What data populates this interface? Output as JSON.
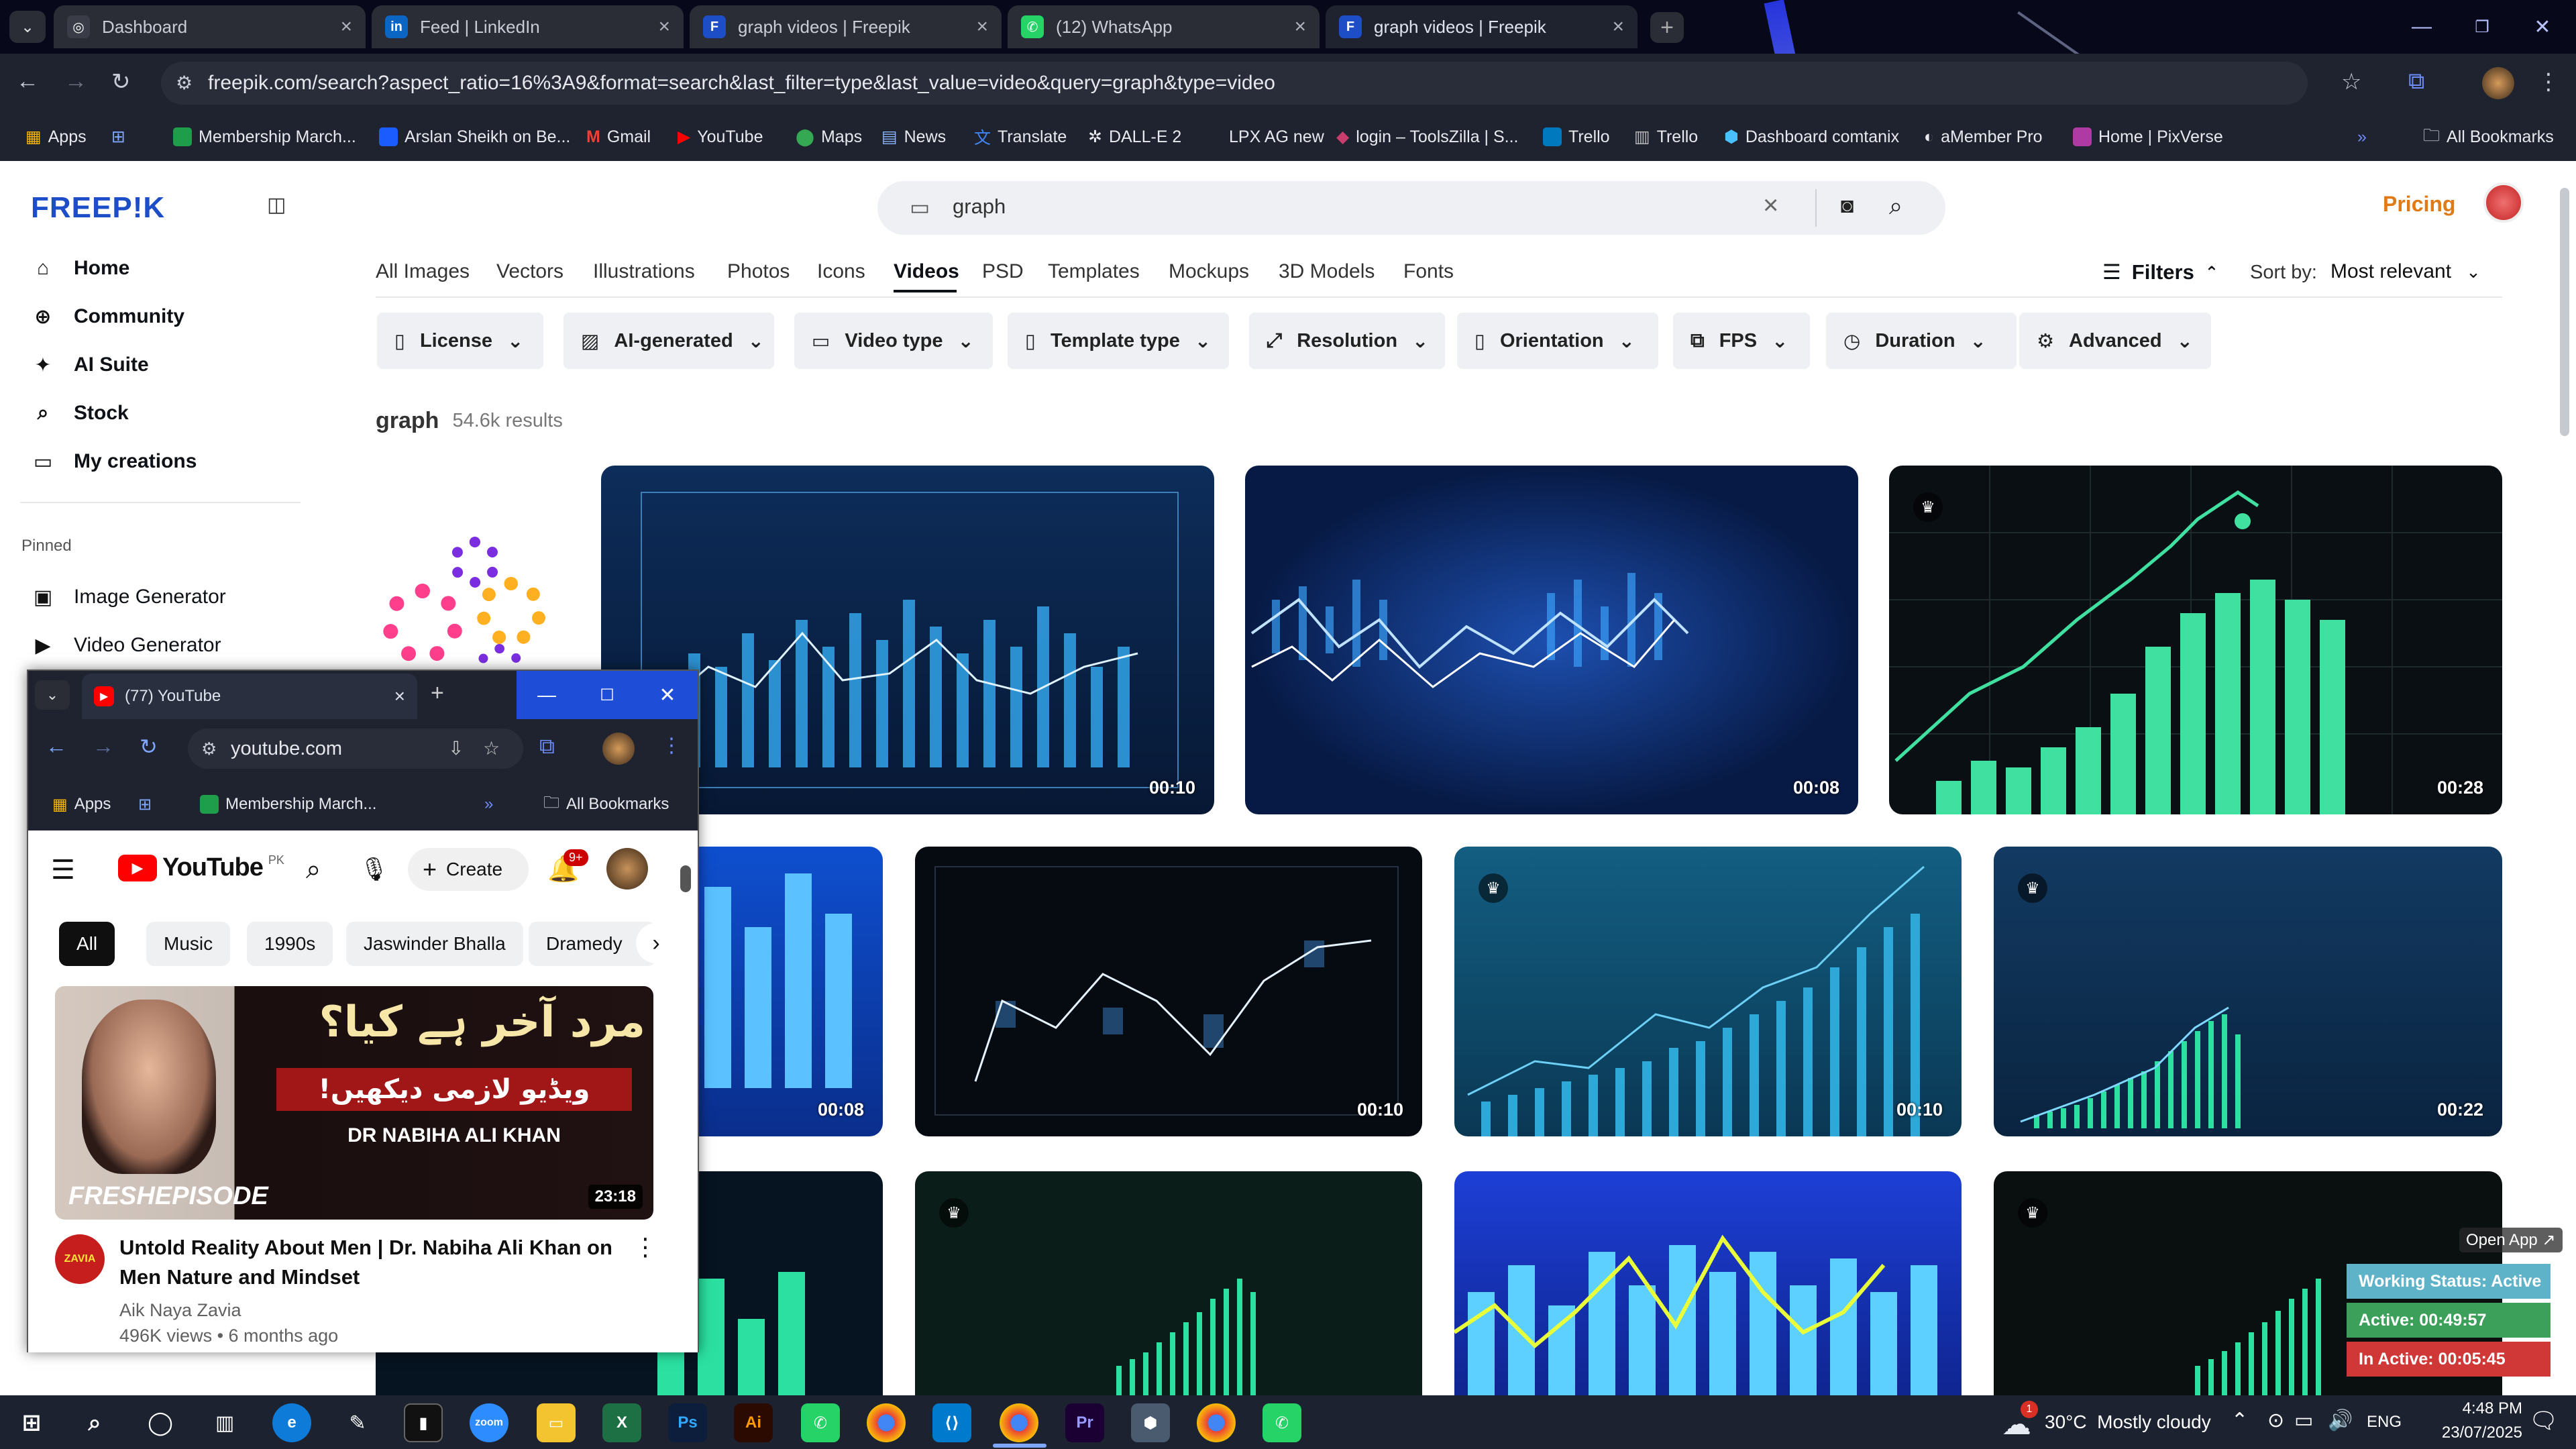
{
  "browser": {
    "tabs": [
      {
        "title": "Dashboard",
        "favicon": "globe-icon"
      },
      {
        "title": "Feed | LinkedIn",
        "favicon": "linkedin-icon"
      },
      {
        "title": "graph videos | Freepik",
        "favicon": "freepik-icon"
      },
      {
        "title": "(12) WhatsApp",
        "favicon": "whatsapp-icon"
      },
      {
        "title": "graph videos | Freepik",
        "favicon": "freepik-icon"
      }
    ],
    "url": "freepik.com/search?aspect_ratio=16%3A9&format=search&last_filter=type&last_value=video&query=graph&type=video",
    "bookmarks": [
      "Apps",
      "Membership March...",
      "Arslan Sheikh on Be...",
      "Gmail",
      "YouTube",
      "Maps",
      "News",
      "Translate",
      "DALL-E 2",
      "LPX AG new",
      "login – ToolsZilla | S...",
      "Trello",
      "Trello",
      "Dashboard comtanix",
      "aMember Pro",
      "Home | PixVerse"
    ],
    "all_bookmarks": "All Bookmarks"
  },
  "freepik": {
    "logo": "FREEP!K",
    "nav": [
      "Home",
      "Community",
      "AI Suite",
      "Stock",
      "My creations"
    ],
    "pinned_label": "Pinned",
    "pinned": [
      "Image Generator",
      "Video Generator"
    ],
    "search_value": "graph",
    "pricing": "Pricing",
    "categories": [
      "All Images",
      "Vectors",
      "Illustrations",
      "Photos",
      "Icons",
      "Videos",
      "PSD",
      "Templates",
      "Mockups",
      "3D Models",
      "Fonts"
    ],
    "active_category": "Videos",
    "filters_label": "Filters",
    "sort_label": "Sort by:",
    "sort_value": "Most relevant",
    "chips": [
      "License",
      "AI-generated",
      "Video type",
      "Template type",
      "Resolution",
      "Orientation",
      "FPS",
      "Duration",
      "Advanced"
    ],
    "results_query": "graph",
    "results_count": "54.6k results",
    "durations": [
      "00:10",
      "00:08",
      "00:28",
      "00:08",
      "00:10",
      "00:10",
      "00:22"
    ]
  },
  "youtube_popup": {
    "tab_title": "(77) YouTube",
    "url": "youtube.com",
    "bookmarks": [
      "Apps",
      "Membership March..."
    ],
    "all_bookmarks": "All Bookmarks",
    "logo_text": "YouTube",
    "region": "PK",
    "create_label": "Create",
    "notif_count": "9+",
    "chips": [
      "All",
      "Music",
      "1990s",
      "Jaswinder Bhalla",
      "Dramedy"
    ],
    "thumbnail": {
      "urdu_title": "مرد آخر ہے کیا؟",
      "urdu_sub": "ویڈیو لازمی دیکھیں!",
      "guest": "DR NABIHA ALI KHAN",
      "badge": "FRESHEPISODE",
      "duration": "23:18"
    },
    "video_title": "Untold Reality About Men | Dr. Nabiha Ali Khan on Men Nature and Mindset",
    "channel": "Aik Naya Zavia",
    "meta": "496K views • 6 months ago",
    "channel_avatar_text": "ZAVIA"
  },
  "status_widget": {
    "open_app": "Open App ↗",
    "working": "Working Status: Active",
    "active": "Active: 00:49:57",
    "inactive": "In Active: 00:05:45"
  },
  "taskbar": {
    "weather": "30°C  Mostly cloudy",
    "lang": "ENG",
    "time": "4:48 PM",
    "date": "23/07/2025",
    "weather_badge": "1"
  },
  "colors": {
    "accent": "#1d4dc7",
    "pricing": "#e07a16",
    "chart_teal": "#3fe0a0"
  }
}
